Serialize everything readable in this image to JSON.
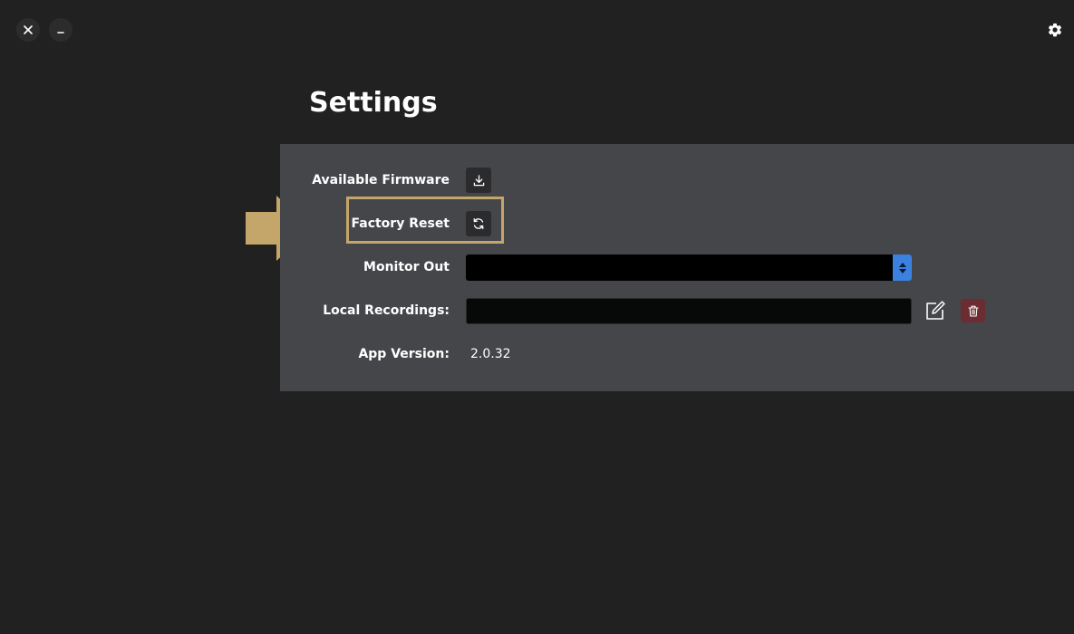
{
  "window_controls": {
    "close_glyph": "✕",
    "minimize_glyph": "_"
  },
  "icons": {
    "close": "close-icon",
    "minimize": "minimize-icon",
    "settings": "gear-icon",
    "download": "download-icon",
    "refresh": "refresh-icon",
    "edit": "edit-icon",
    "delete": "trash-icon",
    "select_arrows": "up-down-chevron-icon",
    "annotation_arrow": "right-arrow-icon"
  },
  "page": {
    "title": "Settings"
  },
  "settings": {
    "firmware_label": "Available Firmware",
    "factory_reset_label": "Factory Reset",
    "monitor_out_label": "Monitor Out",
    "monitor_out_value": "",
    "local_recordings_label": "Local Recordings:",
    "local_recordings_value": "",
    "app_version_label": "App Version:",
    "app_version_value": "2.0.32"
  },
  "colors": {
    "background": "#212121",
    "panel": "#45464a",
    "highlight": "#c4a66a",
    "select_accent": "#3b82e0",
    "delete_button": "#6b2d32"
  }
}
